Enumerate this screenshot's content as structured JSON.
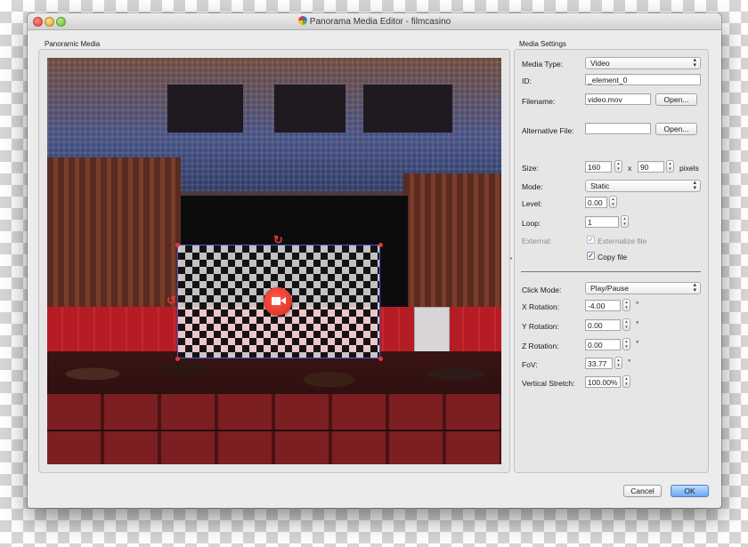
{
  "window": {
    "title": "Panorama Media Editor - filmcasino"
  },
  "left_panel": {
    "label": "Panoramic Media"
  },
  "right_panel": {
    "label": "Media Settings",
    "media_type": {
      "label": "Media Type:",
      "value": "Video"
    },
    "id": {
      "label": "ID:",
      "value": "_element_0"
    },
    "filename": {
      "label": "Filename:",
      "value": "video.mov",
      "button": "Open..."
    },
    "alt_file": {
      "label": "Alternative File:",
      "value": "",
      "button": "Open..."
    },
    "size": {
      "label": "Size:",
      "width": "160",
      "x": "x",
      "height": "90",
      "unit": "pixels"
    },
    "mode": {
      "label": "Mode:",
      "value": "Static"
    },
    "level": {
      "label": "Level:",
      "value": "0.00"
    },
    "loop": {
      "label": "Loop:",
      "value": "1"
    },
    "external": {
      "label": "External:",
      "externalize_label": "Externalize file",
      "externalize_checked": true,
      "externalize_enabled": false
    },
    "copy_file": {
      "label": "Copy file",
      "checked": true
    },
    "click_mode": {
      "label": "Click Mode:",
      "value": "Play/Pause"
    },
    "x_rotation": {
      "label": "X Rotation:",
      "value": "-4.00",
      "unit": "°"
    },
    "y_rotation": {
      "label": "Y Rotation:",
      "value": "0.00",
      "unit": "°"
    },
    "z_rotation": {
      "label": "Z Rotation:",
      "value": "0.00",
      "unit": "°"
    },
    "fov": {
      "label": "FoV:",
      "value": "33.77",
      "unit": "°"
    },
    "vertical_stretch": {
      "label": "Vertical Stretch:",
      "value": "100.00%"
    }
  },
  "footer": {
    "cancel": "Cancel",
    "ok": "OK"
  },
  "icons": {
    "close": "close-icon",
    "minimize": "minimize-icon",
    "maximize": "maximize-icon",
    "app": "app-icon",
    "popup_arrows": "up-down-arrows-icon",
    "stepper": "stepper-icon",
    "video": "video-camera-icon",
    "rotate": "rotate-icon",
    "check": "checkmark-icon"
  },
  "colors": {
    "accent": "#3b7ddd",
    "handle": "#e53935",
    "selection_border": "#4b5ad0"
  }
}
